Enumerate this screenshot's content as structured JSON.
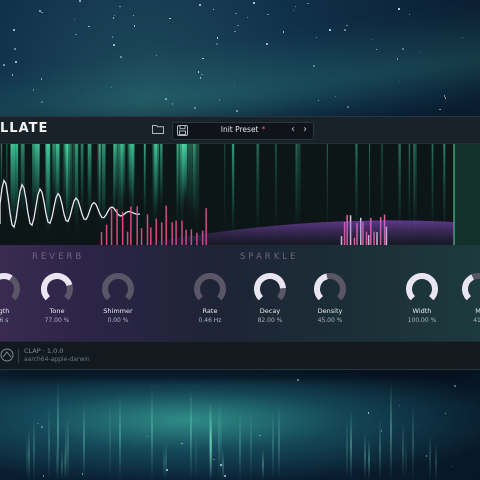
{
  "plugin": {
    "title": "LLATE",
    "preset": {
      "name": "Init Preset",
      "modified_marker": "*",
      "prev_label": "‹",
      "next_label": "›"
    },
    "icons": {
      "folder": "folder-icon",
      "save": "save-icon",
      "logo": "aurora-logo-icon"
    },
    "colors": {
      "accent_pink": "#ff4f7b",
      "accent_teal": "#3fd9b0",
      "knob_fill": "#e9e6f2",
      "knob_track": "#5a5666"
    }
  },
  "sections": {
    "reverb": "REVERB",
    "sparkle": "SPARKLE"
  },
  "knobs": [
    {
      "id": "length",
      "label": "gth",
      "value": "6 s",
      "fraction": 0.62
    },
    {
      "id": "tone",
      "label": "Tone",
      "value": "77.00 %",
      "fraction": 0.77
    },
    {
      "id": "shimmer",
      "label": "Shimmer",
      "value": "0.00 %",
      "fraction": 0.0
    },
    {
      "id": "rate",
      "label": "Rate",
      "value": "0.46 Hz",
      "fraction": 0.0
    },
    {
      "id": "decay",
      "label": "Decay",
      "value": "82.00 %",
      "fraction": 0.82
    },
    {
      "id": "density",
      "label": "Density",
      "value": "45.00 %",
      "fraction": 0.45
    },
    {
      "id": "width",
      "label": "Width",
      "value": "100.00 %",
      "fraction": 1.0
    },
    {
      "id": "mix",
      "label": "M",
      "value": "41.",
      "fraction": 0.41
    }
  ],
  "footer": {
    "format": "CLAP · 1.0.0",
    "platform": "aarch64-apple-darwin"
  }
}
